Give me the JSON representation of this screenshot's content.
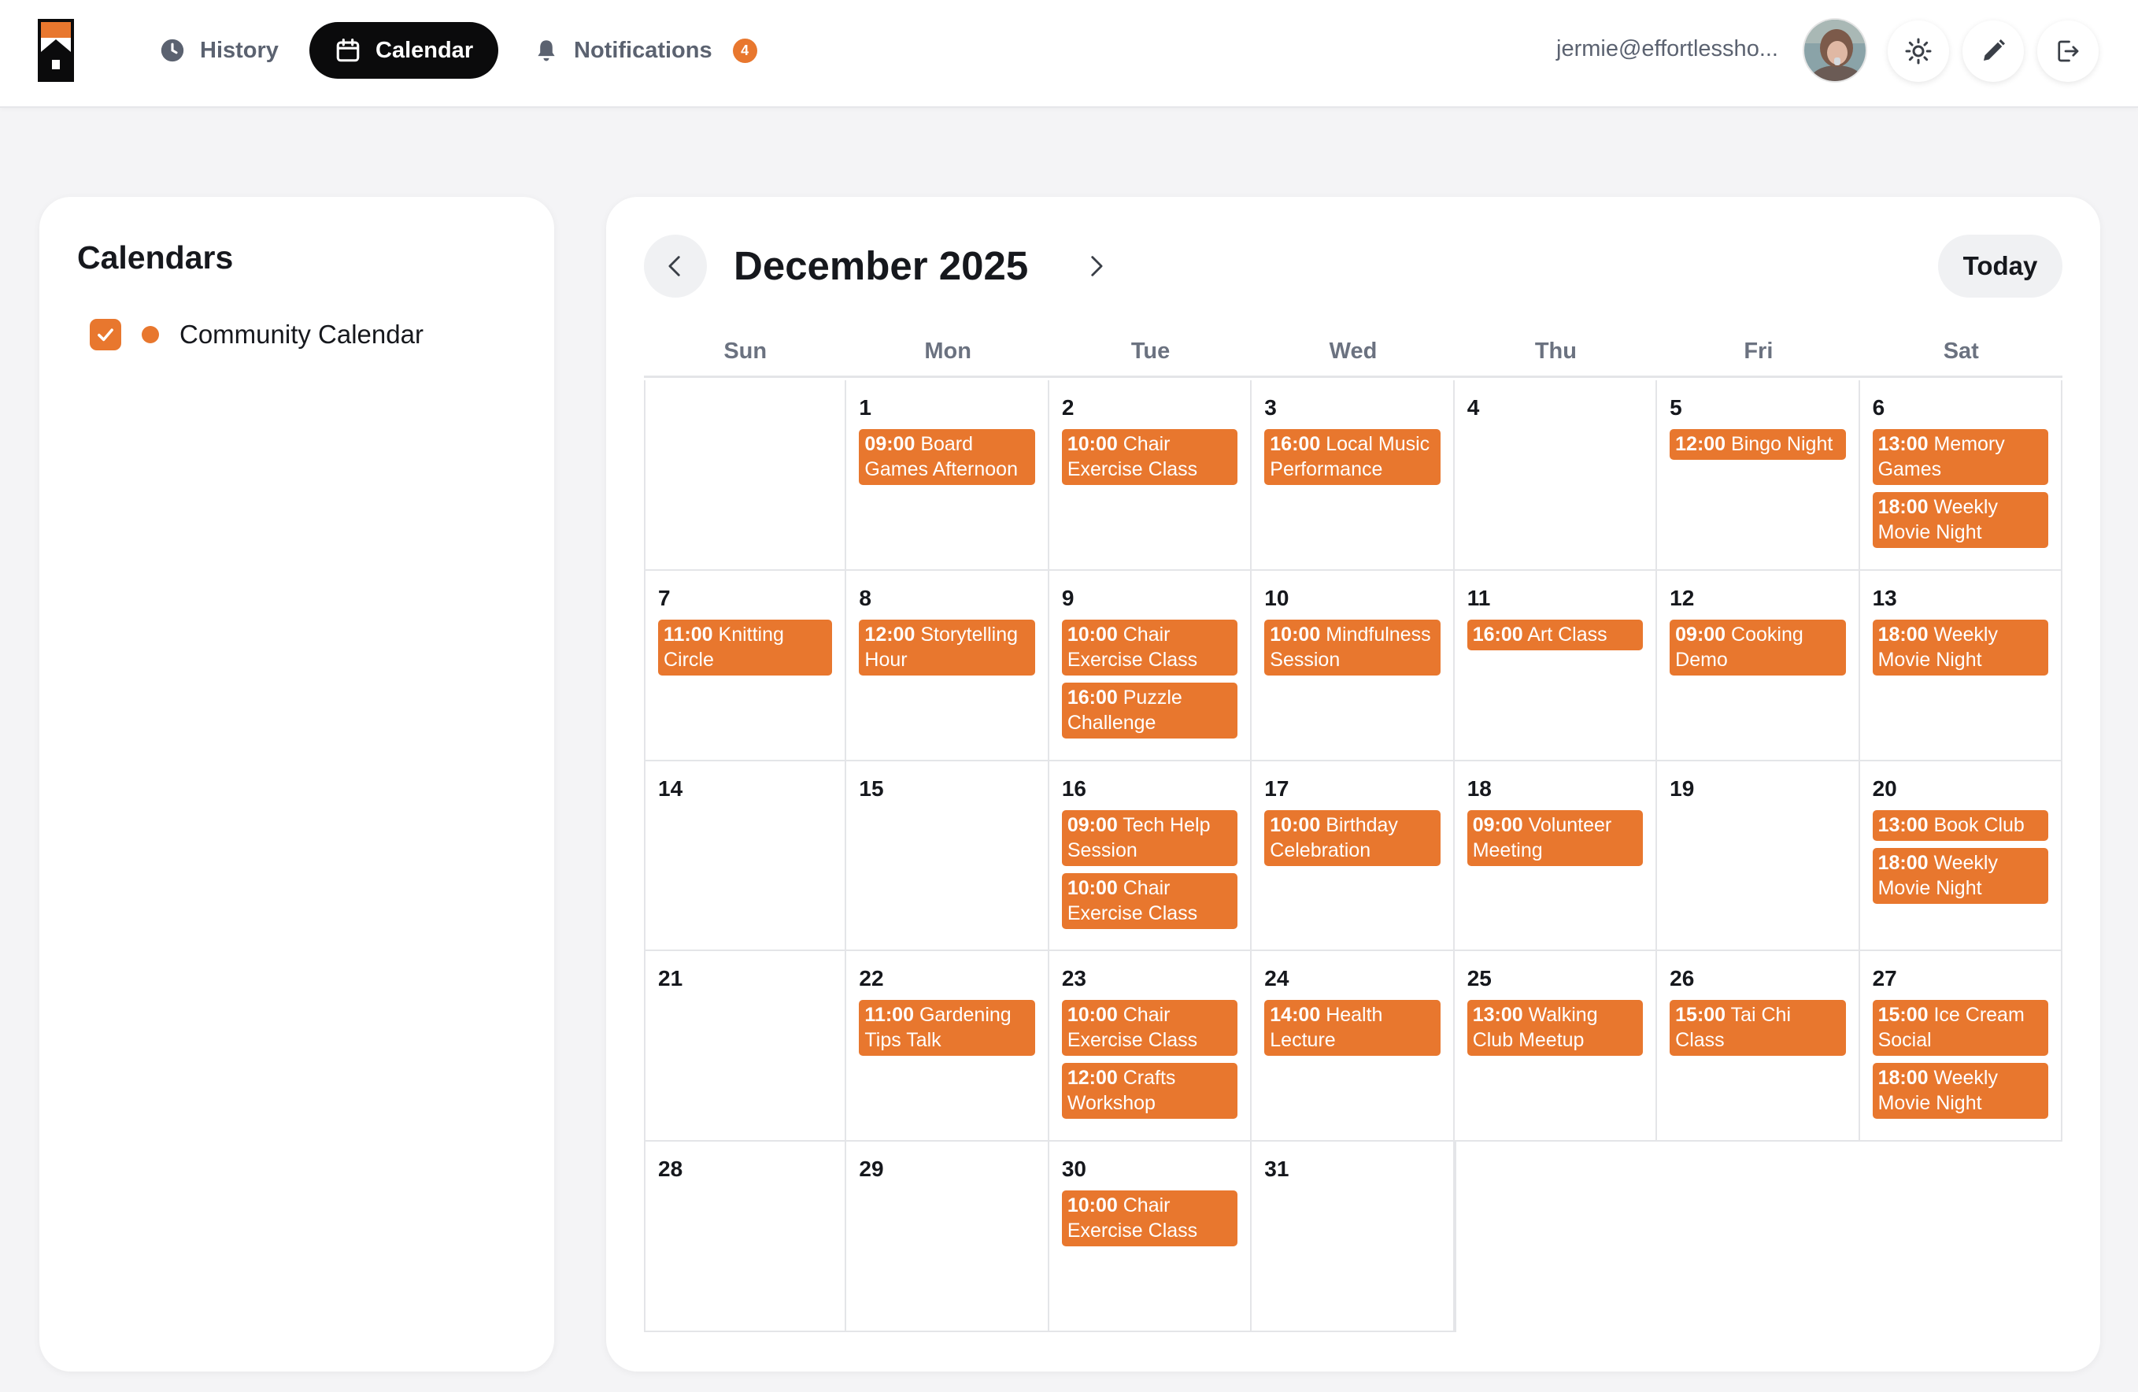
{
  "header": {
    "nav": [
      {
        "key": "history",
        "label": "History",
        "icon": "clock-icon"
      },
      {
        "key": "calendar",
        "label": "Calendar",
        "icon": "calendar-icon",
        "active": true
      },
      {
        "key": "notifications",
        "label": "Notifications",
        "icon": "bell-icon",
        "badge": "4"
      }
    ],
    "user_email": "jermie@effortlessho...",
    "actions": [
      "theme-toggle-sun-icon",
      "edit-pencil-icon",
      "logout-icon"
    ]
  },
  "sidebar": {
    "title": "Calendars",
    "calendars": [
      {
        "name": "Community Calendar",
        "checked": true,
        "color": "#e8772e"
      }
    ]
  },
  "calendar": {
    "month_title": "December 2025",
    "today_label": "Today",
    "weekdays": [
      "Sun",
      "Mon",
      "Tue",
      "Wed",
      "Thu",
      "Fri",
      "Sat"
    ],
    "event_color": "#e8772e",
    "weeks": [
      [
        {
          "day": "",
          "events": []
        },
        {
          "day": "1",
          "events": [
            {
              "time": "09:00",
              "title": "Board Games Afternoon"
            }
          ]
        },
        {
          "day": "2",
          "events": [
            {
              "time": "10:00",
              "title": "Chair Exercise Class"
            }
          ]
        },
        {
          "day": "3",
          "events": [
            {
              "time": "16:00",
              "title": "Local Music Performance"
            }
          ]
        },
        {
          "day": "4",
          "events": []
        },
        {
          "day": "5",
          "events": [
            {
              "time": "12:00",
              "title": "Bingo Night"
            }
          ]
        },
        {
          "day": "6",
          "events": [
            {
              "time": "13:00",
              "title": "Memory Games"
            },
            {
              "time": "18:00",
              "title": "Weekly Movie Night"
            }
          ]
        }
      ],
      [
        {
          "day": "7",
          "events": [
            {
              "time": "11:00",
              "title": "Knitting Circle"
            }
          ]
        },
        {
          "day": "8",
          "events": [
            {
              "time": "12:00",
              "title": "Storytelling Hour"
            }
          ]
        },
        {
          "day": "9",
          "events": [
            {
              "time": "10:00",
              "title": "Chair Exercise Class"
            },
            {
              "time": "16:00",
              "title": "Puzzle Challenge"
            }
          ]
        },
        {
          "day": "10",
          "events": [
            {
              "time": "10:00",
              "title": "Mindfulness Session"
            }
          ]
        },
        {
          "day": "11",
          "events": [
            {
              "time": "16:00",
              "title": "Art Class"
            }
          ]
        },
        {
          "day": "12",
          "events": [
            {
              "time": "09:00",
              "title": "Cooking Demo"
            }
          ]
        },
        {
          "day": "13",
          "events": [
            {
              "time": "18:00",
              "title": "Weekly Movie Night"
            }
          ]
        }
      ],
      [
        {
          "day": "14",
          "events": []
        },
        {
          "day": "15",
          "events": []
        },
        {
          "day": "16",
          "events": [
            {
              "time": "09:00",
              "title": "Tech Help Session"
            },
            {
              "time": "10:00",
              "title": "Chair Exercise Class"
            }
          ]
        },
        {
          "day": "17",
          "events": [
            {
              "time": "10:00",
              "title": "Birthday Celebration"
            }
          ]
        },
        {
          "day": "18",
          "events": [
            {
              "time": "09:00",
              "title": "Volunteer Meeting"
            }
          ]
        },
        {
          "day": "19",
          "events": []
        },
        {
          "day": "20",
          "events": [
            {
              "time": "13:00",
              "title": "Book Club"
            },
            {
              "time": "18:00",
              "title": "Weekly Movie Night"
            }
          ]
        }
      ],
      [
        {
          "day": "21",
          "events": []
        },
        {
          "day": "22",
          "events": [
            {
              "time": "11:00",
              "title": "Gardening Tips Talk"
            }
          ]
        },
        {
          "day": "23",
          "events": [
            {
              "time": "10:00",
              "title": "Chair Exercise Class"
            },
            {
              "time": "12:00",
              "title": "Crafts Workshop"
            }
          ]
        },
        {
          "day": "24",
          "events": [
            {
              "time": "14:00",
              "title": "Health Lecture"
            }
          ]
        },
        {
          "day": "25",
          "events": [
            {
              "time": "13:00",
              "title": "Walking Club Meetup"
            }
          ]
        },
        {
          "day": "26",
          "events": [
            {
              "time": "15:00",
              "title": "Tai Chi Class"
            }
          ]
        },
        {
          "day": "27",
          "events": [
            {
              "time": "15:00",
              "title": "Ice Cream Social"
            },
            {
              "time": "18:00",
              "title": "Weekly Movie Night"
            }
          ]
        }
      ],
      [
        {
          "day": "28",
          "events": []
        },
        {
          "day": "29",
          "events": []
        },
        {
          "day": "30",
          "events": [
            {
              "time": "10:00",
              "title": "Chair Exercise Class"
            }
          ]
        },
        {
          "day": "31",
          "events": []
        },
        {
          "day": "",
          "events": [],
          "tail": true
        },
        {
          "day": "",
          "events": [],
          "tail": true
        },
        {
          "day": "",
          "events": [],
          "tail": true
        }
      ]
    ]
  }
}
